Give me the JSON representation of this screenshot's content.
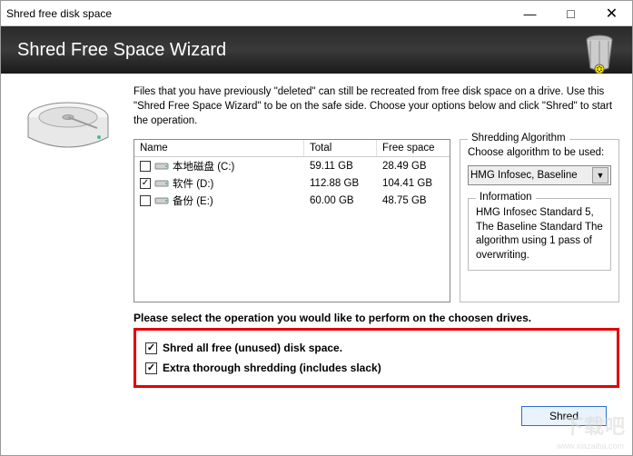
{
  "window": {
    "title": "Shred free disk space"
  },
  "header": {
    "title": "Shred Free Space Wizard"
  },
  "intro": "Files that you have previously \"deleted\" can still be recreated from free disk space on a drive. Use this \"Shred Free Space Wizard\" to be on the safe side. Choose your options below and click \"Shred\" to start the operation.",
  "table": {
    "cols": {
      "name": "Name",
      "total": "Total",
      "free": "Free space"
    },
    "rows": [
      {
        "checked": false,
        "label": "本地磁盘 (C:)",
        "total": "59.11 GB",
        "free": "28.49 GB"
      },
      {
        "checked": true,
        "label": "软件 (D:)",
        "total": "112.88 GB",
        "free": "104.41 GB"
      },
      {
        "checked": false,
        "label": "备份 (E:)",
        "total": "60.00 GB",
        "free": "48.75 GB"
      }
    ]
  },
  "algo": {
    "legend": "Shredding Algorithm",
    "choose_label": "Choose algorithm to be used:",
    "selected": "HMG Infosec, Baseline",
    "info_legend": "Information",
    "info_text": "HMG Infosec Standard 5, The Baseline Standard The algorithm using 1 pass of overwriting."
  },
  "ops": {
    "title": "Please select the operation you would like to perform on the choosen drives.",
    "opt1": {
      "checked": true,
      "label": "Shred all free (unused) disk space."
    },
    "opt2": {
      "checked": true,
      "label": "Extra thorough shredding (includes slack)"
    }
  },
  "buttons": {
    "shred": "Shred"
  },
  "watermark": {
    "main": "下载吧",
    "sub": "www.xiazaiba.com"
  }
}
